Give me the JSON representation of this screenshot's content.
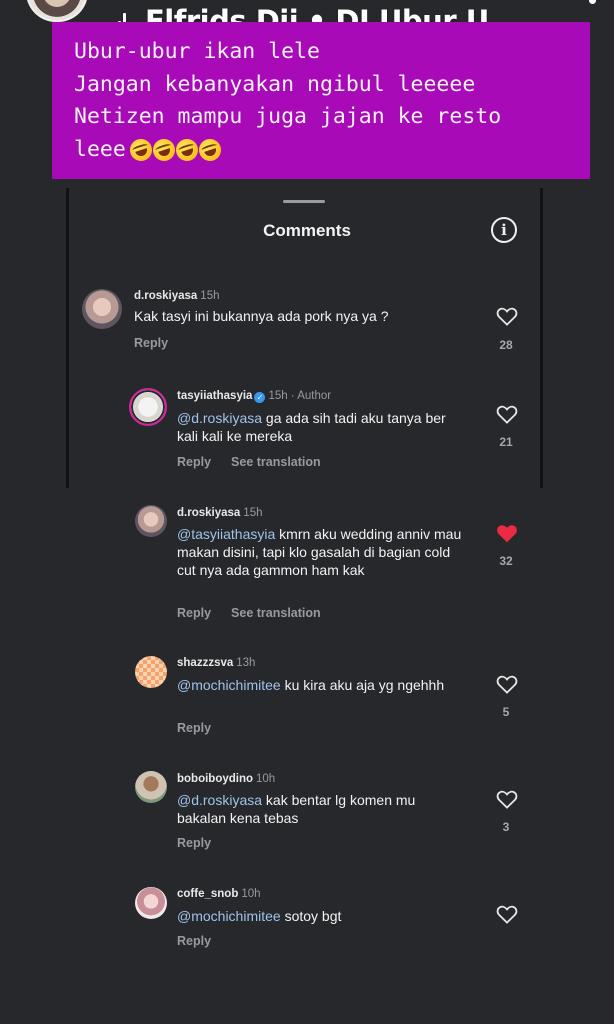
{
  "story": {
    "title": "Elfrids Dji • DJ Ubur U...",
    "caption_lines": [
      "Ubur-ubur ikan lele",
      "Jangan kebanyakan ngibul leeeee",
      "Netizen mampu juga jajan ke resto",
      "leee"
    ],
    "caption_emoji": [
      "rolling-on-floor-laughing",
      "rolling-on-floor-laughing",
      "rolling-on-floor-laughing",
      "rolling-on-floor-laughing"
    ]
  },
  "comments_sheet": {
    "title": "Comments",
    "info_icon": "info-icon"
  },
  "comments": [
    {
      "username": "d.roskiyasa",
      "time": "15h",
      "author_label": "",
      "mention": "",
      "text": "Kak tasyi ini bukannya ada pork nya ya ?",
      "reply": "Reply",
      "see_translation": "",
      "likes": "28",
      "liked": false
    },
    {
      "username": "tasyiiathasyia",
      "time": "15h",
      "author_label": "· Author",
      "mention": "@d.roskiyasa",
      "text": " ga ada sih tadi aku tanya ber kali kali ke mereka",
      "reply": "Reply",
      "see_translation": "See translation",
      "likes": "21",
      "liked": false
    },
    {
      "username": "d.roskiyasa",
      "time": "15h",
      "author_label": "",
      "mention": "@tasyiiathasyia",
      "text": " kmrn aku wedding anniv mau makan disini, tapi klo gasalah di bagian cold cut nya ada gammon ham kak",
      "reply": "Reply",
      "see_translation": "See translation",
      "likes": "32",
      "liked": true
    },
    {
      "username": "shazzzsva",
      "time": "13h",
      "author_label": "",
      "mention": "@mochichimitee",
      "text": " ku kira aku aja yg ngehhh",
      "reply": "Reply",
      "see_translation": "",
      "likes": "5",
      "liked": false
    },
    {
      "username": "boboiboydino",
      "time": "10h",
      "author_label": "",
      "mention": "@d.roskiyasa",
      "text": " kak bentar lg komen mu bakalan kena tebas",
      "reply": "Reply",
      "see_translation": "",
      "likes": "3",
      "liked": false
    },
    {
      "username": "coffe_snob",
      "time": "10h",
      "author_label": "",
      "mention": "@mochichimitee",
      "text": " sotoy bgt",
      "reply": "Reply",
      "see_translation": "",
      "likes": "",
      "liked": false
    }
  ],
  "colors": {
    "background": "#26282c",
    "caption_bg": "#a80ab8",
    "mention": "#9fc3ea",
    "liked_heart": "#ed2a43",
    "verified": "#3897f0"
  }
}
